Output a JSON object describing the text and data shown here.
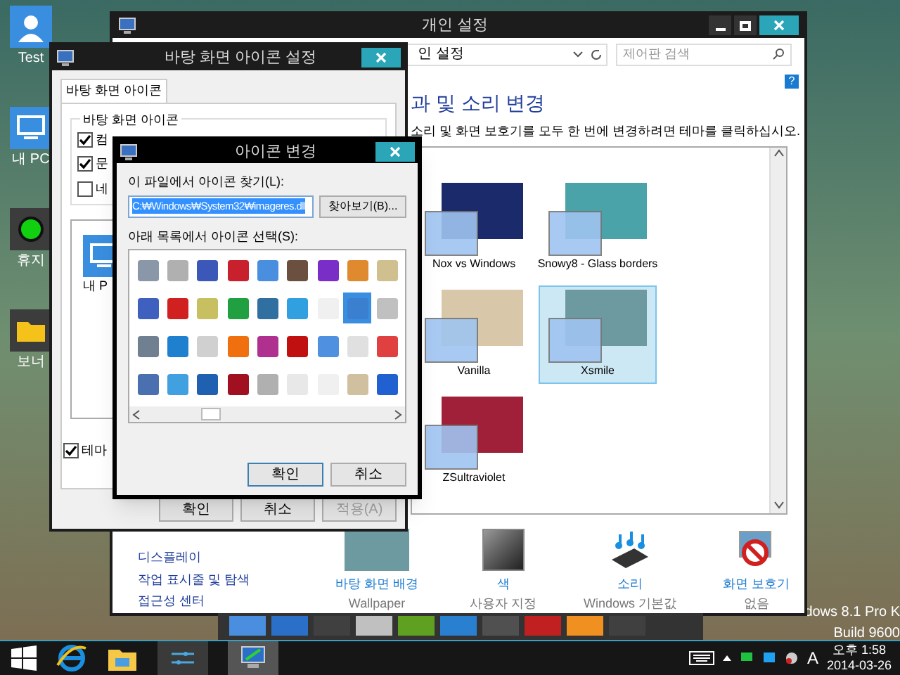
{
  "desktop_icons": [
    {
      "label": "Test",
      "kind": "user"
    },
    {
      "label": "내 PC",
      "kind": "pc"
    },
    {
      "label": "휴지",
      "kind": "light"
    },
    {
      "label": "보너",
      "kind": "folder"
    }
  ],
  "desktop_watermark_text": [
    "dows 8.1 Pro K",
    "Build 9600"
  ],
  "personalization": {
    "title": "개인 설정",
    "address": "인 설정",
    "search_placeholder": "제어판 검색",
    "help": "?",
    "heading": "과 및 소리 변경",
    "subtext": "소리 및 화면 보호기를 모두 한 번에 변경하려면 테마를 클릭하십시오.",
    "themes": [
      {
        "name": "Nox vs Windows",
        "selected": false,
        "color": "#1b2a6b"
      },
      {
        "name": "Snowy8 - Glass borders",
        "selected": false,
        "color": "#4aa3a8"
      },
      {
        "name": "Vanilla",
        "selected": false,
        "color": "#d8c7a8"
      },
      {
        "name": "Xsmile",
        "selected": true,
        "color": "#6d9aa0"
      },
      {
        "name": "ZSultraviolet",
        "selected": false,
        "color": "#a0203a"
      }
    ],
    "links": [
      "디스플레이",
      "작업 표시줄 및 탐색",
      "접근성 센터"
    ],
    "settings": [
      {
        "kind": "wallpaper",
        "title": "바탕 화면 배경",
        "value": "Wallpaper"
      },
      {
        "kind": "color",
        "title": "색",
        "value": "사용자 지정"
      },
      {
        "kind": "sound",
        "title": "소리",
        "value": "Windows 기본값"
      },
      {
        "kind": "saver",
        "title": "화면 보호기",
        "value": "없음"
      }
    ]
  },
  "desktop_icon_settings": {
    "title": "바탕 화면 아이콘 설정",
    "tab": "바탕 화면 아이콘",
    "group": "바탕 화면 아이콘",
    "checkboxes": [
      {
        "label": "컴",
        "checked": true
      },
      {
        "label": "문",
        "checked": true
      },
      {
        "label": "네",
        "checked": false
      }
    ],
    "preview_label": "내 P",
    "theme_checkbox": {
      "label": "테마",
      "checked": true
    },
    "buttons": [
      {
        "label": "확인",
        "disabled": false
      },
      {
        "label": "취소",
        "disabled": false
      },
      {
        "label": "적용(A)",
        "disabled": true
      }
    ]
  },
  "change_icon": {
    "title": "아이콘 변경",
    "file_label": "이 파일에서 아이콘 찾기(L):",
    "file_value": "C:₩Windows₩System32₩imageres.dll",
    "browse": "찾아보기(B)...",
    "list_label": "아래 목록에서 아이콘 선택(S):",
    "icons": [
      {
        "color": "#8a97a8",
        "selected": false
      },
      {
        "color": "#b0b0b0",
        "selected": false
      },
      {
        "color": "#3b57b8",
        "selected": false
      },
      {
        "color": "#c8202c",
        "selected": false
      },
      {
        "color": "#4a8ee0",
        "selected": false
      },
      {
        "color": "#6b5040",
        "selected": false
      },
      {
        "color": "#7a2ec8",
        "selected": false
      },
      {
        "color": "#e08a30",
        "selected": false
      },
      {
        "color": "#d0c090",
        "selected": false
      },
      {
        "color": "#4060c0",
        "selected": false
      },
      {
        "color": "#d02020",
        "selected": false
      },
      {
        "color": "#c8c060",
        "selected": false
      },
      {
        "color": "#20a040",
        "selected": false
      },
      {
        "color": "#3070a0",
        "selected": false
      },
      {
        "color": "#30a0e0",
        "selected": false
      },
      {
        "color": "#f0f0f0",
        "selected": false
      },
      {
        "color": "#3a7fd0",
        "selected": true
      },
      {
        "color": "#c0c0c0",
        "selected": false
      },
      {
        "color": "#708090",
        "selected": false
      },
      {
        "color": "#2080d0",
        "selected": false
      },
      {
        "color": "#d0d0d0",
        "selected": false
      },
      {
        "color": "#f07010",
        "selected": false
      },
      {
        "color": "#b03090",
        "selected": false
      },
      {
        "color": "#c01010",
        "selected": false
      },
      {
        "color": "#5090e0",
        "selected": false
      },
      {
        "color": "#e0e0e0",
        "selected": false
      },
      {
        "color": "#e04040",
        "selected": false
      },
      {
        "color": "#4a70b0",
        "selected": false
      },
      {
        "color": "#40a0e0",
        "selected": false
      },
      {
        "color": "#2060b0",
        "selected": false
      },
      {
        "color": "#a01020",
        "selected": false
      },
      {
        "color": "#b0b0b0",
        "selected": false
      },
      {
        "color": "#e8e8e8",
        "selected": false
      },
      {
        "color": "#f0f0f0",
        "selected": false
      },
      {
        "color": "#d0c0a0",
        "selected": false
      },
      {
        "color": "#2060d0",
        "selected": false
      }
    ],
    "buttons": [
      {
        "label": "확인",
        "default": true
      },
      {
        "label": "취소",
        "default": false
      }
    ]
  },
  "dock": [
    {
      "color": "#4a8ee0"
    },
    {
      "color": "#2a70c8"
    },
    {
      "color": "#404040"
    },
    {
      "color": "#c0c0c0"
    },
    {
      "color": "#60a020"
    },
    {
      "color": "#2a80d0"
    },
    {
      "color": "#505050"
    },
    {
      "color": "#c02020"
    },
    {
      "color": "#f09020"
    },
    {
      "color": "#404040"
    }
  ],
  "taskbar": {
    "tasks": [
      {
        "kind": "start"
      },
      {
        "kind": "browser"
      },
      {
        "kind": "folder"
      },
      {
        "kind": "sliders"
      },
      {
        "kind": "monitor"
      }
    ],
    "ime": "A",
    "time": "오후 1:58",
    "date": "2014-03-26"
  }
}
